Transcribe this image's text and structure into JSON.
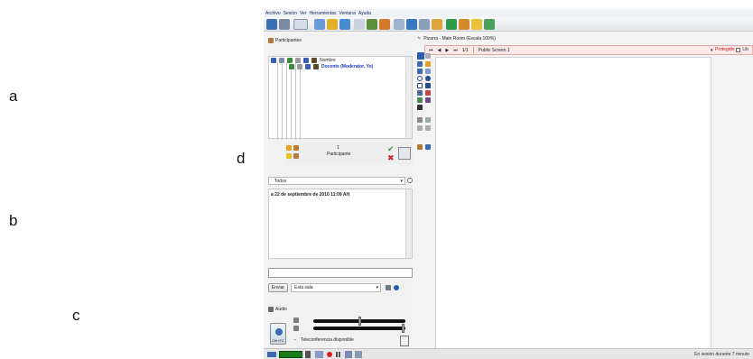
{
  "side_labels": {
    "a": "a",
    "b": "b",
    "c": "c",
    "d": "d"
  },
  "menu": [
    "Archivo",
    "Sesión",
    "Ver",
    "Herramientas",
    "Ventana",
    "Ayuda"
  ],
  "participants": {
    "header": "Participantes",
    "column_header_name": "Nombre",
    "rows": [
      {
        "name": "Docente (Moderator, Yo)"
      }
    ],
    "count": "1",
    "count_label": "Participante"
  },
  "chat": {
    "filter_value": "Todos",
    "message": "a 22 de septiembre de 2010 11:09 AH",
    "send_label": "Enviar",
    "room_value": "Esta sala"
  },
  "audio": {
    "header": "Audio",
    "talk_shortcut": "Ctrl+F2",
    "teleconference": "Teleconferencia disponible"
  },
  "whiteboard": {
    "title": "Pizarra - Main Room (Escala 100%)",
    "page": "1/1",
    "screen": "Public Screen 1",
    "protect_label": "Protegido",
    "extra_checkbox_label": "Lib"
  },
  "status": {
    "text": "En sesión durante 7 minuto"
  },
  "colors": {
    "accent_red": "#c01818",
    "moderator_blue": "#1a3cbf",
    "meter_green": "#1a7d1a"
  }
}
